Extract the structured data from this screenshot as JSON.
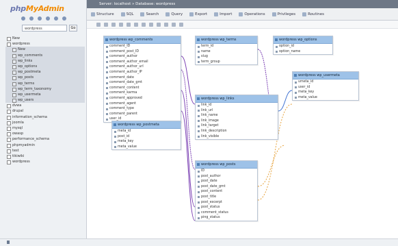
{
  "logo": {
    "php": "php",
    "my": "MyAdmin"
  },
  "sidebar": {
    "db_select": "wordpress",
    "go_label": "Go",
    "tree": [
      {
        "label": "New",
        "sub": false
      },
      {
        "label": "wordpress",
        "sub": false
      },
      {
        "label": "New",
        "sub": true
      },
      {
        "label": "wp_comments",
        "sub": true
      },
      {
        "label": "wp_links",
        "sub": true
      },
      {
        "label": "wp_options",
        "sub": true
      },
      {
        "label": "wp_postmeta",
        "sub": true
      },
      {
        "label": "wp_posts",
        "sub": true
      },
      {
        "label": "wp_terms",
        "sub": true
      },
      {
        "label": "wp_term_taxonomy",
        "sub": true
      },
      {
        "label": "wp_usermeta",
        "sub": true
      },
      {
        "label": "wp_users",
        "sub": true
      },
      {
        "label": "dvwa",
        "sub": false
      },
      {
        "label": "drupal",
        "sub": false
      },
      {
        "label": "information_schema",
        "sub": false
      },
      {
        "label": "joomla",
        "sub": false
      },
      {
        "label": "mysql",
        "sub": false
      },
      {
        "label": "owasp",
        "sub": false
      },
      {
        "label": "performance_schema",
        "sub": false
      },
      {
        "label": "phpmyadmin",
        "sub": false
      },
      {
        "label": "test",
        "sub": false
      },
      {
        "label": "tikiwiki",
        "sub": false
      },
      {
        "label": "wordpress",
        "sub": false
      }
    ]
  },
  "topbar": {
    "breadcrumb": "Server: localhost » Database: wordpress"
  },
  "tabs": [
    "Structure",
    "SQL",
    "Search",
    "Query",
    "Export",
    "Import",
    "Operations",
    "Privileges",
    "Routines"
  ],
  "colors": {
    "topbar": "#6e7886",
    "table_header": "#9ec2e8",
    "link_purple": "#7a3fb3",
    "link_orange": "#e6a23c",
    "link_blue": "#3b6fd1"
  },
  "tables": [
    {
      "name": "wordpress wp_comments",
      "columns": [
        "comment_ID",
        "comment_post_ID",
        "comment_author",
        "comment_author_email",
        "comment_author_url",
        "comment_author_IP",
        "comment_date",
        "comment_date_gmt",
        "comment_content",
        "comment_karma",
        "comment_approved",
        "comment_agent",
        "comment_type",
        "comment_parent",
        "user_id"
      ]
    },
    {
      "name": "wordpress wp_terms",
      "columns": [
        "term_id",
        "name",
        "slug",
        "term_group"
      ]
    },
    {
      "name": "wordpress wp_links",
      "columns": [
        "link_id",
        "link_url",
        "link_name",
        "link_image",
        "link_target",
        "link_description",
        "link_visible"
      ]
    },
    {
      "name": "wordpress wp_options",
      "columns": [
        "option_id",
        "option_name"
      ]
    },
    {
      "name": "wordpress wp_usermeta",
      "columns": [
        "umeta_id",
        "user_id",
        "meta_key",
        "meta_value"
      ]
    },
    {
      "name": "wordpress wp_posts",
      "columns": [
        "ID",
        "post_author",
        "post_date",
        "post_date_gmt",
        "post_content",
        "post_title",
        "post_excerpt",
        "post_status",
        "comment_status",
        "ping_status"
      ]
    },
    {
      "name": "wordpress wp_postmeta",
      "columns": [
        "meta_id",
        "post_id",
        "meta_key",
        "meta_value"
      ]
    },
    {
      "name": "wordpress wp_users",
      "columns": [
        "ID",
        "user_login",
        "user_pass",
        "user_nicename",
        "user_email",
        "user_url",
        "user_registered",
        "user_activation_key",
        "user_status",
        "display_name",
        "spam",
        "deleted"
      ]
    }
  ]
}
